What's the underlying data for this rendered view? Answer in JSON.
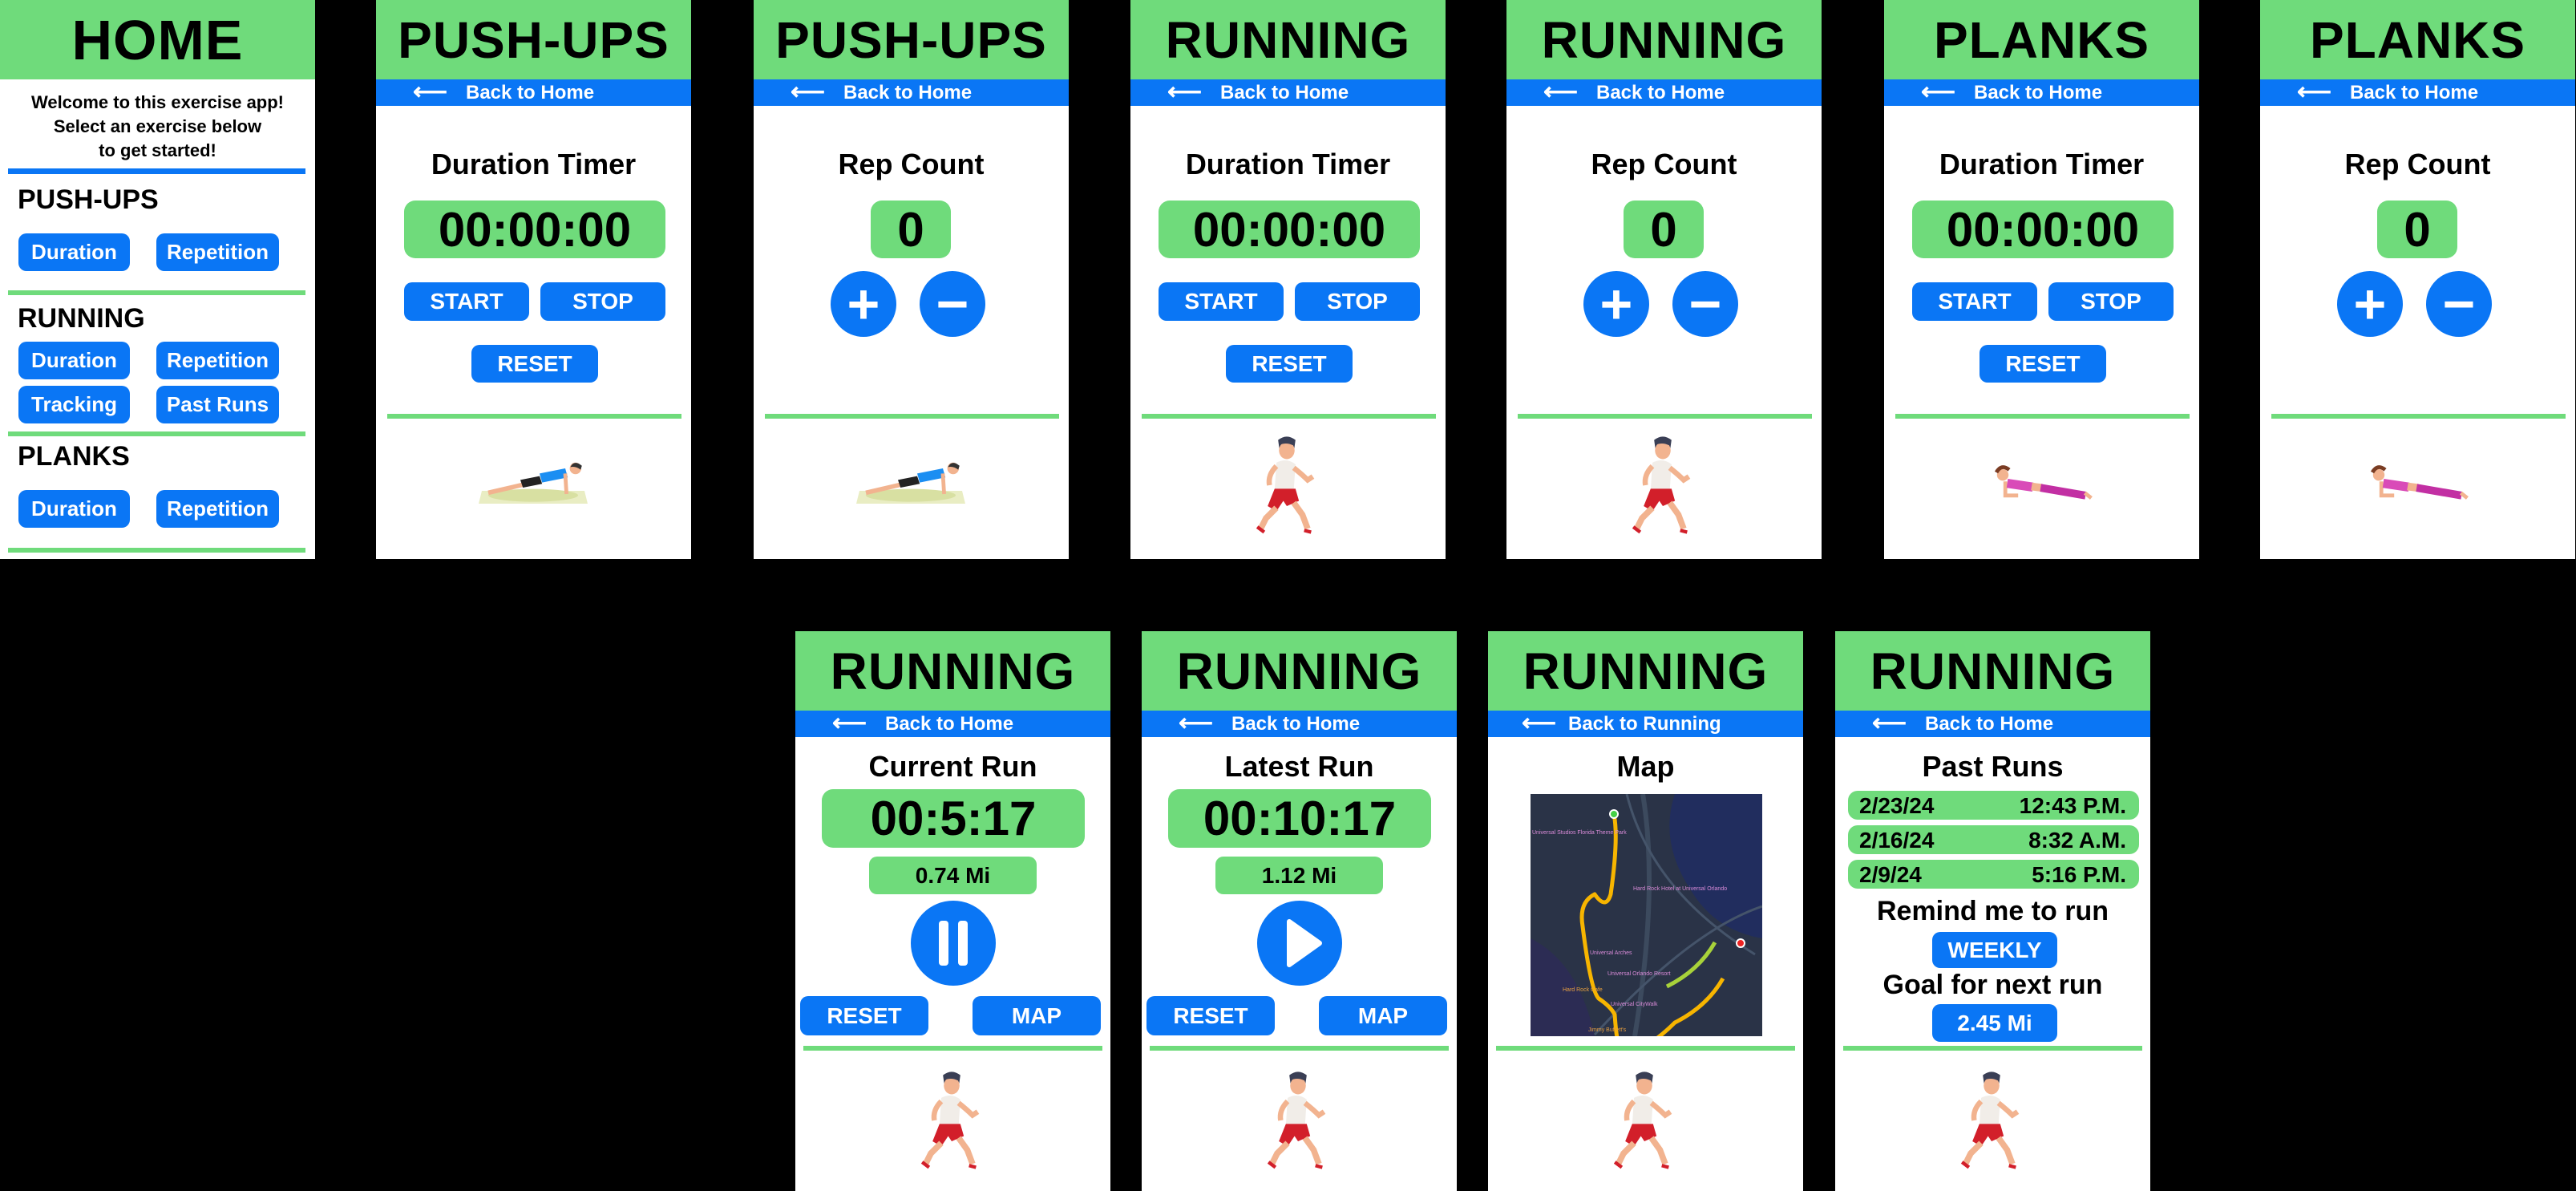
{
  "colors": {
    "green": "#6fdb7b",
    "blue": "#0a76f5"
  },
  "home": {
    "title": "HOME",
    "welcome": [
      "Welcome to this exercise app!",
      "Select an exercise below",
      "to get started!"
    ],
    "pushups": {
      "title": "PUSH-UPS",
      "duration": "Duration",
      "repetition": "Repetition"
    },
    "running": {
      "title": "RUNNING",
      "duration": "Duration",
      "repetition": "Repetition",
      "tracking": "Tracking",
      "past_runs": "Past Runs"
    },
    "planks": {
      "title": "PLANKS",
      "duration": "Duration",
      "repetition": "Repetition"
    }
  },
  "back_arrow": "⟵",
  "screens": {
    "pushups_duration": {
      "title": "PUSH-UPS",
      "back": "Back to Home",
      "heading": "Duration Timer",
      "timer": "00:00:00",
      "start": "START",
      "stop": "STOP",
      "reset": "RESET",
      "image": "push-up-figure"
    },
    "pushups_reps": {
      "title": "PUSH-UPS",
      "back": "Back to Home",
      "heading": "Rep Count",
      "count": "0",
      "plus": "+",
      "minus": "−",
      "image": "push-up-figure"
    },
    "running_duration": {
      "title": "RUNNING",
      "back": "Back to Home",
      "heading": "Duration Timer",
      "timer": "00:00:00",
      "start": "START",
      "stop": "STOP",
      "reset": "RESET",
      "image": "runner-figure"
    },
    "running_reps": {
      "title": "RUNNING",
      "back": "Back to Home",
      "heading": "Rep Count",
      "count": "0",
      "plus": "+",
      "minus": "−",
      "image": "runner-figure"
    },
    "planks_duration": {
      "title": "PLANKS",
      "back": "Back to Home",
      "heading": "Duration Timer",
      "timer": "00:00:00",
      "start": "START",
      "stop": "STOP",
      "reset": "RESET",
      "image": "plank-figure"
    },
    "planks_reps": {
      "title": "PLANKS",
      "back": "Back to Home",
      "heading": "Rep Count",
      "count": "0",
      "plus": "+",
      "minus": "−",
      "image": "plank-figure"
    },
    "current_run": {
      "title": "RUNNING",
      "back": "Back to Home",
      "heading": "Current Run",
      "timer": "00:5:17",
      "distance": "0.74 Mi",
      "control": "pause-icon",
      "reset": "RESET",
      "map": "MAP"
    },
    "latest_run": {
      "title": "RUNNING",
      "back": "Back to Home",
      "heading": "Latest Run",
      "timer": "00:10:17",
      "distance": "1.12 Mi",
      "control": "play-icon",
      "reset": "RESET",
      "map": "MAP"
    },
    "map": {
      "title": "RUNNING",
      "back": "Back to Running",
      "heading": "Map",
      "labels": [
        "Universal Studios Florida Theme Park",
        "Hard Rock Hotel at Universal Orlando",
        "Universal Arches",
        "Universal Orlando Resort",
        "Hard Rock Cafe",
        "Universal CityWalk",
        "Jimmy Buffett's"
      ]
    },
    "past_runs": {
      "title": "RUNNING",
      "back": "Back to Home",
      "heading": "Past Runs",
      "runs": [
        {
          "date": "2/23/24",
          "time": "12:43 P.M."
        },
        {
          "date": "2/16/24",
          "time": "8:32 A.M."
        },
        {
          "date": "2/9/24",
          "time": "5:16 P.M."
        }
      ],
      "remind_label": "Remind me to run",
      "remind_value": "WEEKLY",
      "goal_label": "Goal for next run",
      "goal_value": "2.45 Mi"
    }
  }
}
